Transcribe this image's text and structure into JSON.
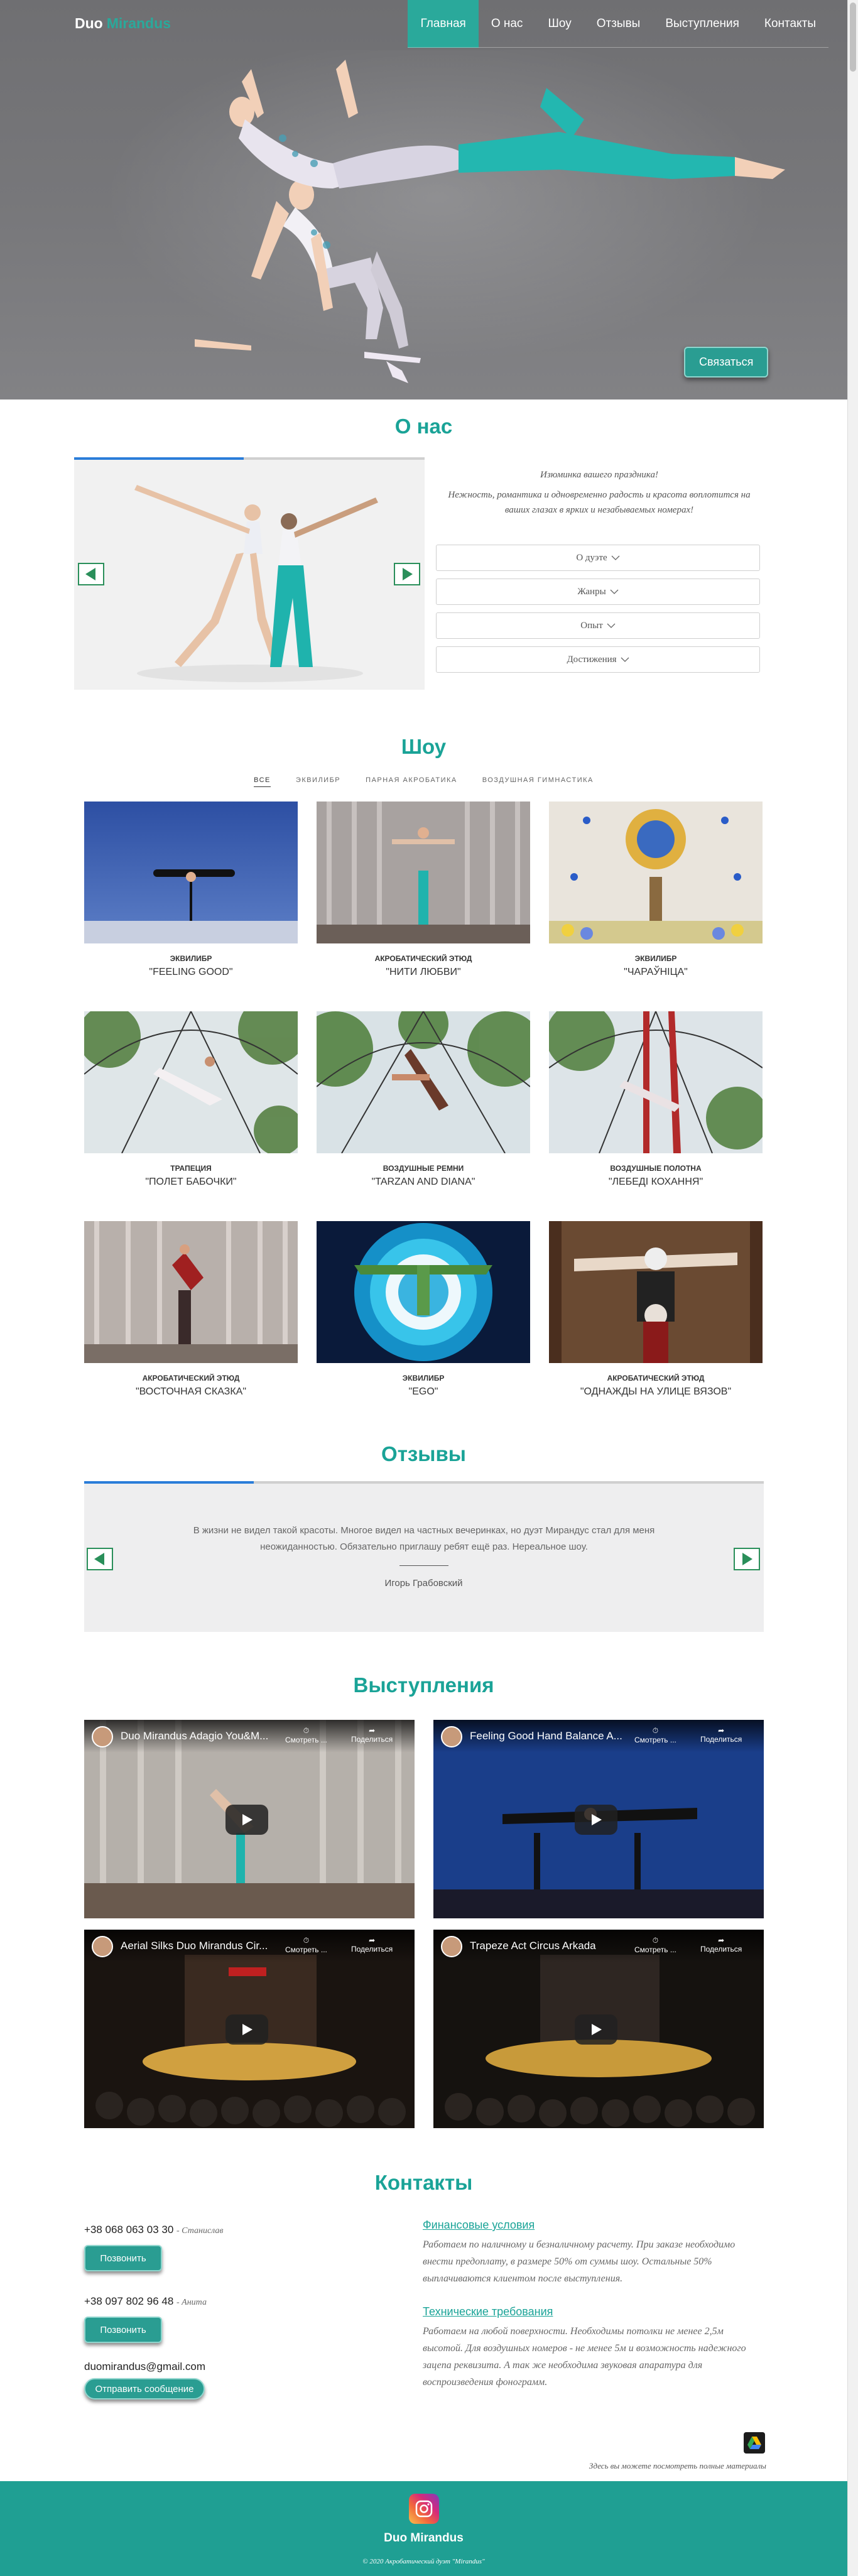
{
  "header": {
    "logo_main": "Duo",
    "logo_accent": "Mirandus",
    "nav": [
      "Главная",
      "О нас",
      "Шоу",
      "Отзывы",
      "Выступления",
      "Контакты"
    ],
    "cta": "Связаться"
  },
  "about": {
    "title": "О нас",
    "line1": "Изюминка вашего праздника!",
    "line2": "Нежность, романтика и одновременно радость и красота воплотится на ваших глазах в ярких и незабываемых номерах!",
    "accordion": [
      "О дуэте",
      "Жанры",
      "Опыт",
      "Достижения"
    ]
  },
  "shows": {
    "title": "Шоу",
    "filters": [
      "ВСЕ",
      "ЭКВИЛИБР",
      "ПАРНАЯ АКРОБАТИКА",
      "ВОЗДУШНАЯ ГИМНАСТИКА"
    ],
    "items": [
      {
        "category": "ЭКВИЛИБР",
        "name": "\"FEELING GOOD\""
      },
      {
        "category": "АКРОБАТИЧЕСКИЙ ЭТЮД",
        "name": "\"НИТИ ЛЮБВИ\""
      },
      {
        "category": "ЭКВИЛИБР",
        "name": "\"ЧАРАЎНІЦА\""
      },
      {
        "category": "ТРАПЕЦИЯ",
        "name": "\"ПОЛЕТ БАБОЧКИ\""
      },
      {
        "category": "ВОЗДУШНЫЕ РЕМНИ",
        "name": "\"TARZAN AND DIANA\""
      },
      {
        "category": "ВОЗДУШНЫЕ ПОЛОТНА",
        "name": "\"ЛЕБЕДІ КОХАННЯ\""
      },
      {
        "category": "АКРОБАТИЧЕСКИЙ ЭТЮД",
        "name": "\"ВОСТОЧНАЯ СКАЗКА\""
      },
      {
        "category": "ЭКВИЛИБР",
        "name": "\"EGO\""
      },
      {
        "category": "АКРОБАТИЧЕСКИЙ ЭТЮД",
        "name": "\"ОДНАЖДЫ НА УЛИЦЕ ВЯЗОВ\""
      }
    ]
  },
  "reviews": {
    "title": "Отзывы",
    "text": "В жизни не видел такой красоты. Многое видел на частных вечеринках, но дуэт Мирандус стал для меня неожиданностью. Обязательно приглашу ребят ещё раз. Нереальное шоу.",
    "author": "Игорь Грабовский"
  },
  "videos": {
    "title": "Выступления",
    "watch_later": "Смотреть ...",
    "share": "Поделиться",
    "items": [
      {
        "title": "Duo Mirandus Adagio You&M..."
      },
      {
        "title": "Feeling Good Hand Balance A..."
      },
      {
        "title": "Aerial Silks Duo Mirandus Cir..."
      },
      {
        "title": "Trapeze Act Circus Arkada"
      }
    ]
  },
  "contacts": {
    "title": "Контакты",
    "phone1": "+38 068 063 03 30",
    "name1": "- Станислав",
    "phone2": "+38 097 802 96 48",
    "name2": "- Анита",
    "call": "Позвонить",
    "email": "duomirandus@gmail.com",
    "send": "Отправить сообщение",
    "fin_title": "Финансовые условия",
    "fin_text": "Работаем по наличному и безналичному расчету. При заказе необходимо внести предоплату, в размере 50% от суммы шоу. Остальные 50% выплачиваются клиентом после выступления.",
    "tech_title": "Технические требования",
    "tech_text": "Работаем на любой поверхности. Необходимы потолки не менее 2,5м высотой. Для воздушных номеров - не менее 5м и возможность надежного зацепа реквизита. А так же необходима звуковая апаратура для воспроизведения фонограмм.",
    "drive_note": "Здесь вы можете посмотреть полные материалы"
  },
  "footer": {
    "title": "Duo Mirandus",
    "copy": "© 2020 Акробатический дуэт \"Mirandus\""
  }
}
